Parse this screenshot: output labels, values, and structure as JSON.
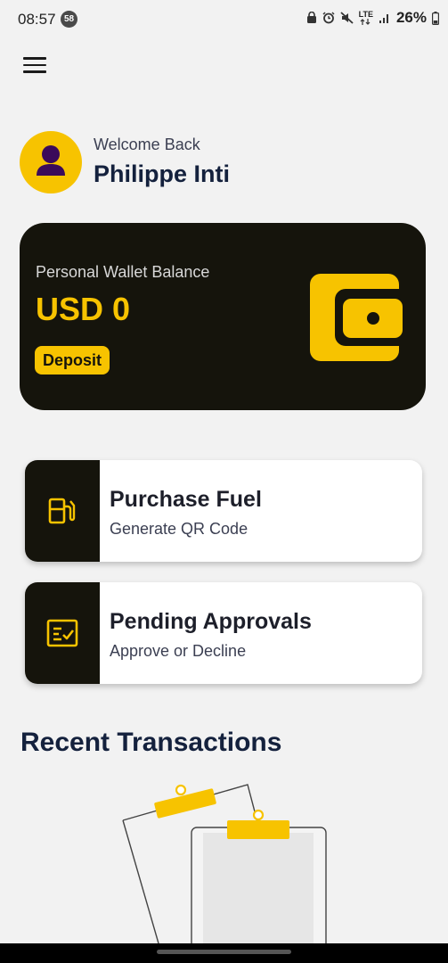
{
  "status_bar": {
    "time": "08:57",
    "notification_count": "58",
    "network": "LTE",
    "battery": "26%"
  },
  "header": {
    "menu_icon": "hamburger-menu-icon"
  },
  "profile": {
    "greeting": "Welcome Back",
    "name": "Philippe Inti",
    "avatar_icon": "person-icon"
  },
  "wallet": {
    "label": "Personal Wallet Balance",
    "amount": "USD 0",
    "deposit_label": "Deposit",
    "icon": "wallet-icon"
  },
  "actions": [
    {
      "title": "Purchase Fuel",
      "subtitle": "Generate QR Code",
      "icon": "fuel-pump-icon"
    },
    {
      "title": "Pending Approvals",
      "subtitle": "Approve or Decline",
      "icon": "checklist-icon"
    }
  ],
  "recent": {
    "title": "Recent Transactions",
    "illustration": "empty-clipboard-illustration"
  },
  "colors": {
    "accent": "#f7c300",
    "card_dark": "#15140c",
    "title_navy": "#14213d",
    "background": "#f2f2f2"
  }
}
